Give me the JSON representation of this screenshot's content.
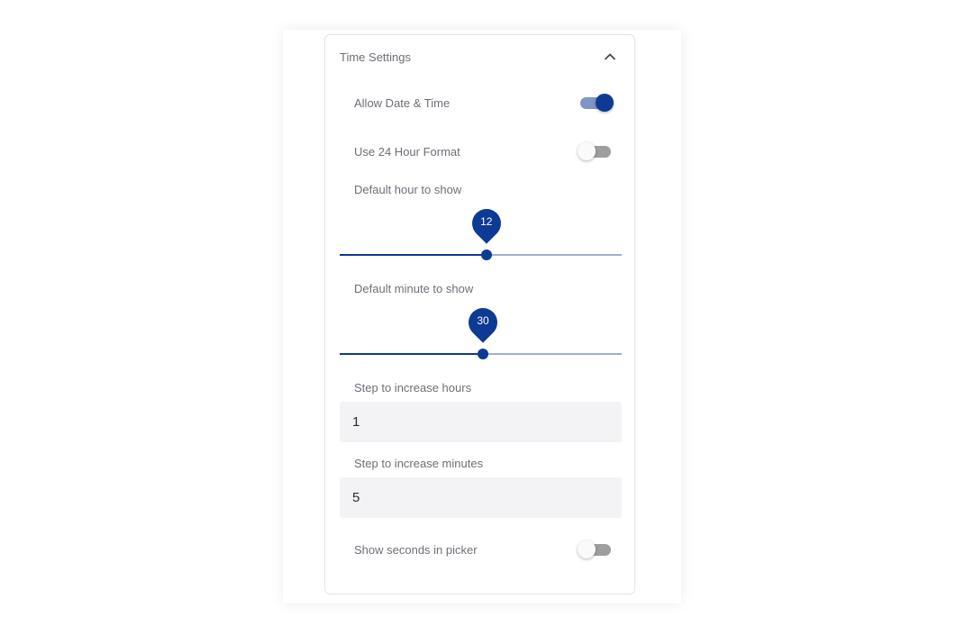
{
  "panel": {
    "title": "Time Settings",
    "collapse_icon": "chevron-up-icon"
  },
  "settings": {
    "allow_date_time": {
      "label": "Allow Date & Time",
      "enabled": true
    },
    "use_24_hour": {
      "label": "Use 24 Hour Format",
      "enabled": false
    },
    "default_hour": {
      "label": "Default hour to show",
      "value": "12",
      "fraction": 0.52
    },
    "default_minute": {
      "label": "Default minute to show",
      "value": "30",
      "fraction": 0.508
    },
    "step_hours": {
      "label": "Step to increase hours",
      "value": "1"
    },
    "step_minutes": {
      "label": "Step to increase minutes",
      "value": "5"
    },
    "show_seconds": {
      "label": "Show seconds in picker",
      "enabled": false
    }
  },
  "colors": {
    "accent": "#0d3a94",
    "accent_light": "#7f95c7",
    "toggle_off_track": "#9e9e9e",
    "field_bg": "#f3f3f5",
    "label_text": "#6e6e78"
  }
}
